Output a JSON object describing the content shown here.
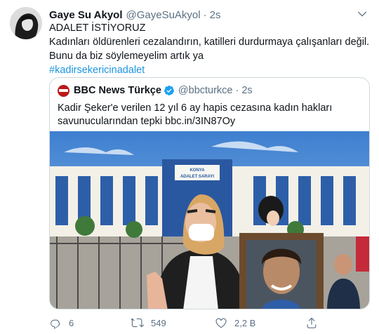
{
  "tweet": {
    "author_name": "Gaye Su Akyol",
    "author_handle": "@GayeSuAkyol",
    "separator": "·",
    "time": "2s",
    "text_line1": "ADALET İSTİYORUZ",
    "text_body": "Kadınları öldürenleri cezalandırın, katilleri durdurmaya çalışanları değil. Bunu da biz söylemeyelim artık ya",
    "hashtag": "#kadirsekericinadalet"
  },
  "quote": {
    "author_name": "BBC News Türkçe",
    "author_handle": "@bbcturkce",
    "separator": "·",
    "time": "2s",
    "text": "Kadir Şeker'e verilen 12 yıl 6 ay hapis cezasına kadın hakları savunucularından tepki bbc.in/3IN87Oy",
    "photo": {
      "building_sign_line1": "KONYA",
      "building_sign_line2": "ADALET SARAYI"
    }
  },
  "actions": {
    "reply_count": "6",
    "retweet_count": "549",
    "like_count": "2,2 B"
  },
  "colors": {
    "link": "#1b95e0",
    "secondary_text": "#5b7083",
    "border": "#cfd9de",
    "bbc_red": "#bb1919"
  },
  "icons": [
    "caret-down-icon",
    "verified-icon",
    "reply-icon",
    "retweet-icon",
    "like-icon",
    "share-icon"
  ]
}
